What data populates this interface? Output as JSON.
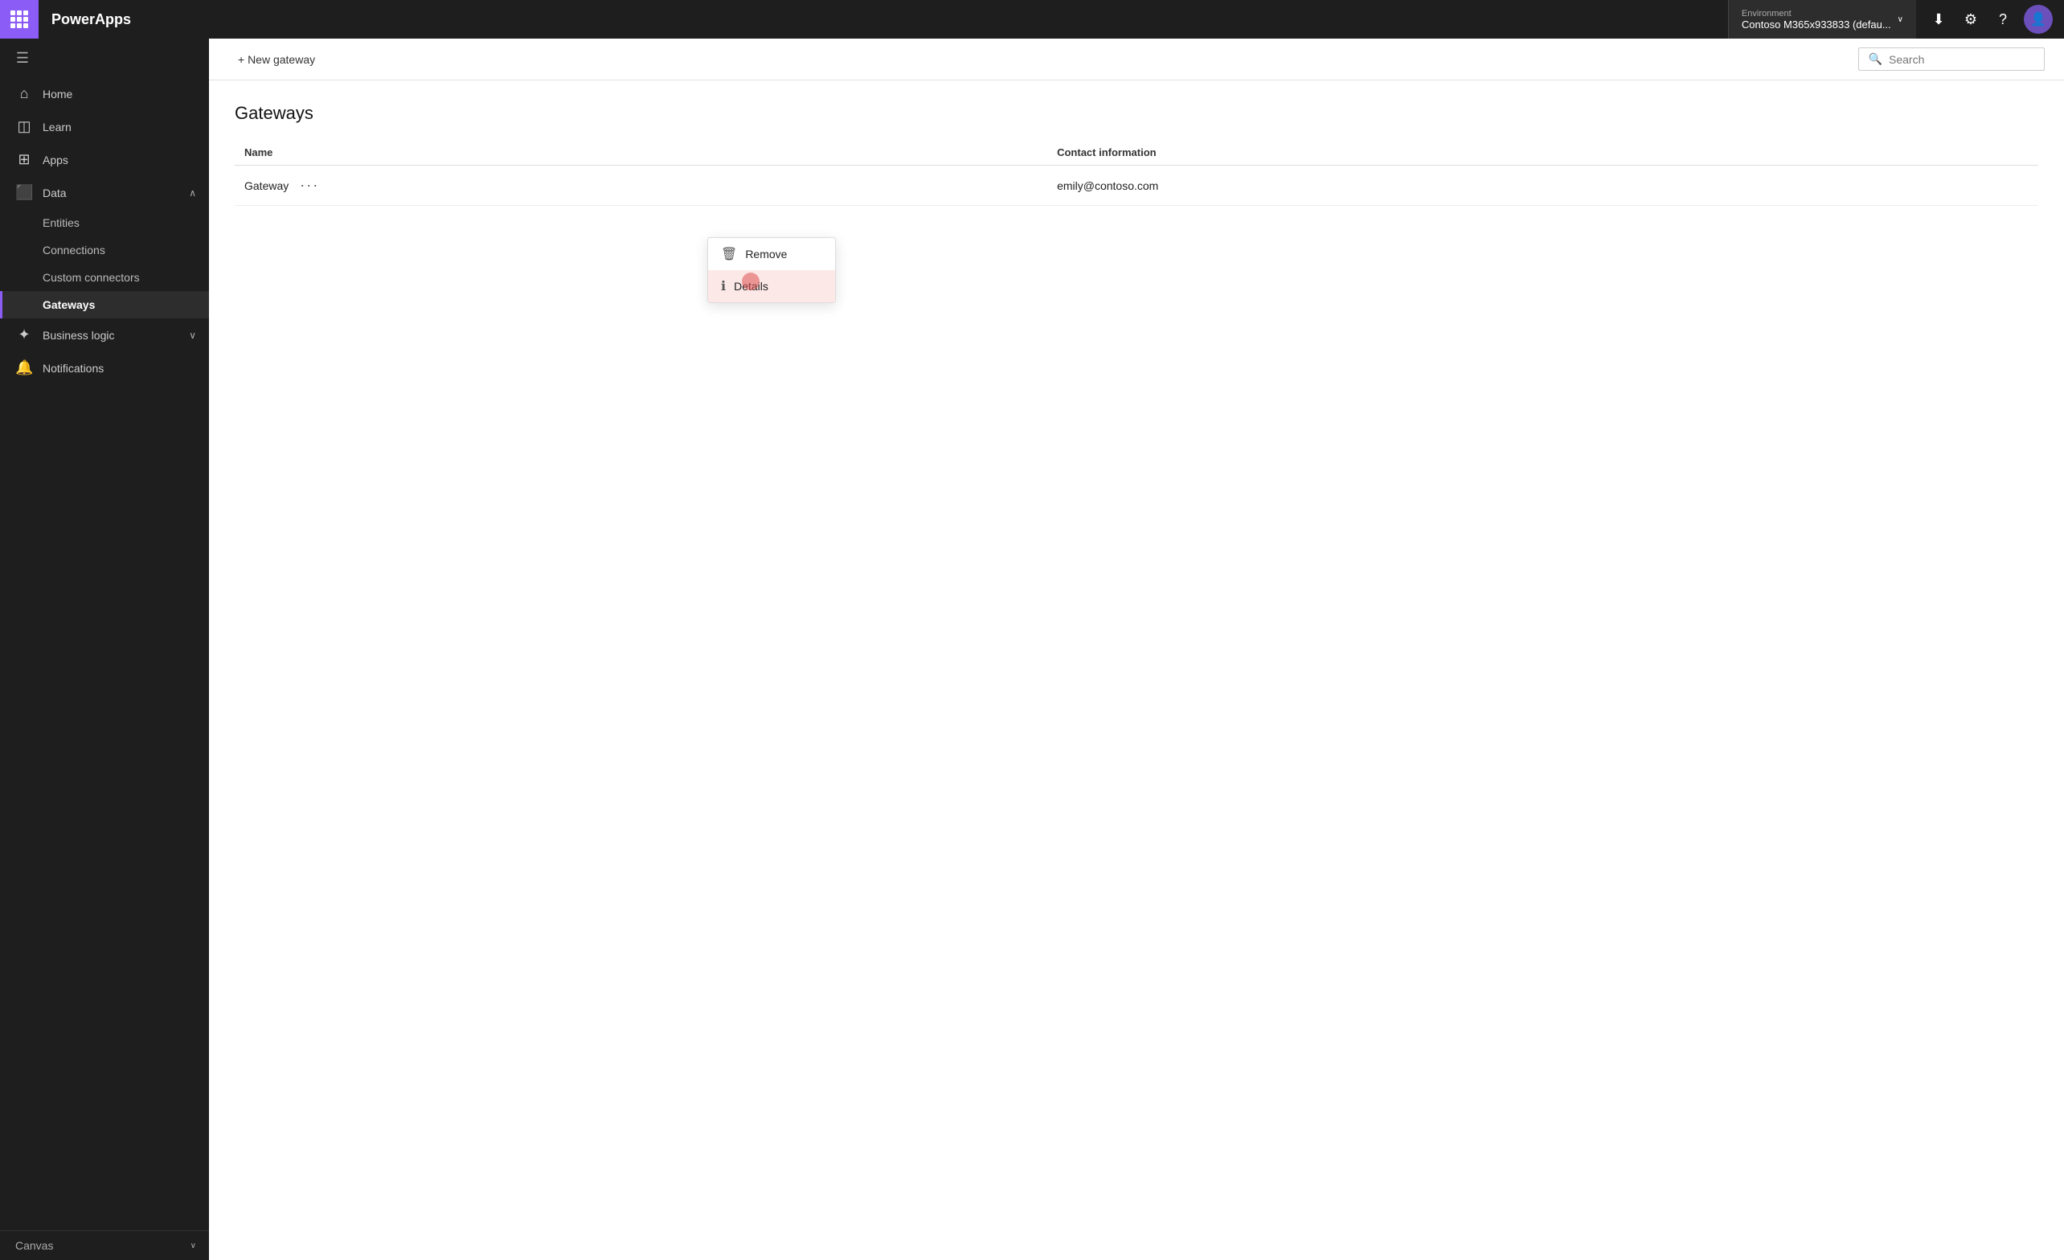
{
  "app": {
    "brand": "PowerApps",
    "waffle_label": "App launcher"
  },
  "topbar": {
    "env_label": "Environment",
    "env_name": "Contoso M365x933833 (defau...",
    "download_icon": "⬇",
    "settings_icon": "⚙",
    "help_icon": "?",
    "avatar_initial": "👤"
  },
  "toolbar": {
    "new_gateway_label": "+ New gateway",
    "search_placeholder": "Search"
  },
  "sidebar": {
    "collapse_icon": "☰",
    "items": [
      {
        "id": "home",
        "icon": "🏠",
        "label": "Home",
        "active": false
      },
      {
        "id": "learn",
        "icon": "📋",
        "label": "Learn",
        "active": false
      },
      {
        "id": "apps",
        "icon": "⬛",
        "label": "Apps",
        "active": false
      },
      {
        "id": "data",
        "icon": "⬛",
        "label": "Data",
        "active": false,
        "expanded": true,
        "chevron": "∧"
      }
    ],
    "data_sub_items": [
      {
        "id": "entities",
        "label": "Entities"
      },
      {
        "id": "connections",
        "label": "Connections"
      },
      {
        "id": "custom-connectors",
        "label": "Custom connectors"
      },
      {
        "id": "gateways",
        "label": "Gateways",
        "active": true
      }
    ],
    "bottom_items": [
      {
        "id": "business-logic",
        "icon": "✦",
        "label": "Business logic",
        "chevron": "∨"
      },
      {
        "id": "notifications",
        "icon": "🔔",
        "label": "Notifications"
      }
    ],
    "footer_items": [
      {
        "id": "canvas",
        "label": "Canvas",
        "chevron": "∨"
      }
    ]
  },
  "page": {
    "title": "Gateways",
    "table": {
      "columns": [
        "Name",
        "Contact information"
      ],
      "rows": [
        {
          "name": "Gateway",
          "contact": "emily@contoso.com"
        }
      ]
    }
  },
  "context_menu": {
    "items": [
      {
        "id": "remove",
        "icon": "🗑",
        "label": "Remove"
      },
      {
        "id": "details",
        "icon": "ℹ",
        "label": "Details",
        "hovered": true
      }
    ]
  }
}
